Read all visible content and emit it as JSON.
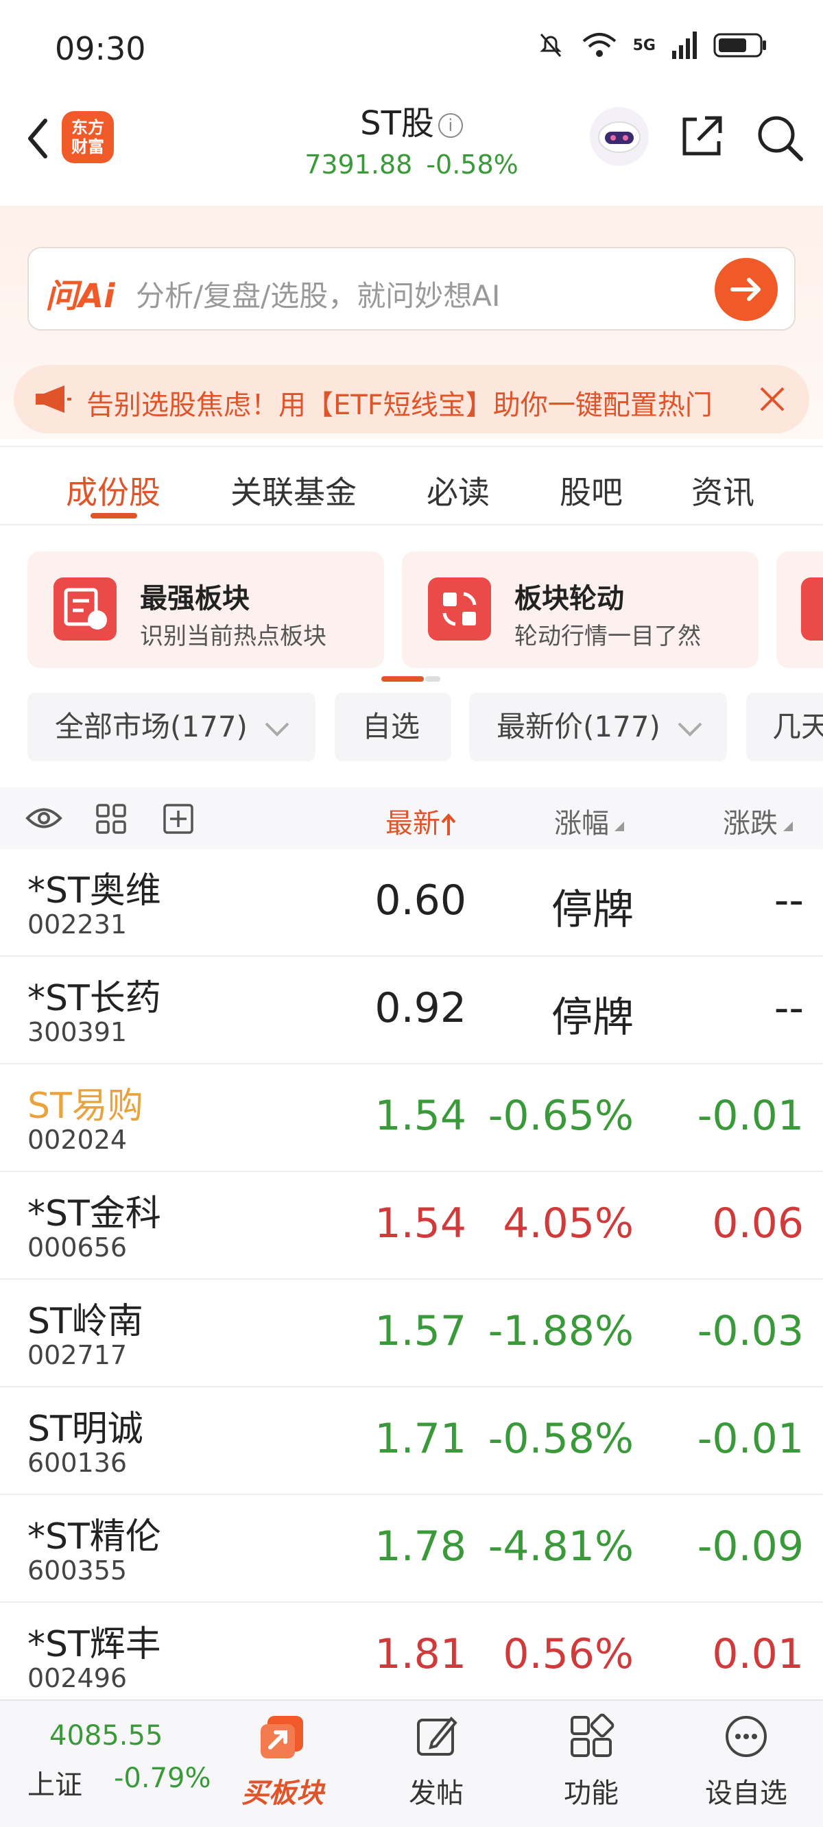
{
  "status": {
    "time": "09:30",
    "network": "5G"
  },
  "header": {
    "logo_line1": "东方",
    "logo_line2": "财富",
    "title": "ST股",
    "index_value": "7391.88",
    "index_change": "-0.58%"
  },
  "ai": {
    "logo": "问Ai",
    "placeholder": "分析/复盘/选股，就问妙想AI"
  },
  "banner": {
    "text": "告别选股焦虑！用【ETF短线宝】助你一键配置热门"
  },
  "tabs": [
    "成份股",
    "关联基金",
    "必读",
    "股吧",
    "资讯"
  ],
  "cards": [
    {
      "title": "最强板块",
      "subtitle": "识别当前热点板块"
    },
    {
      "title": "板块轮动",
      "subtitle": "轮动行情一目了然"
    }
  ],
  "filters": {
    "market": "全部市场(177)",
    "watchlist": "自选",
    "price": "最新价(177)",
    "days": "几天"
  },
  "table": {
    "headers": {
      "latest": "最新",
      "change_pct": "涨幅",
      "change": "涨跌"
    },
    "rows": [
      {
        "name": "*ST奥维",
        "code": "002231",
        "price": "0.60",
        "pct": "停牌",
        "chg": "--",
        "trend": "flat"
      },
      {
        "name": "*ST长药",
        "code": "300391",
        "price": "0.92",
        "pct": "停牌",
        "chg": "--",
        "trend": "flat"
      },
      {
        "name": "ST易购",
        "code": "002024",
        "price": "1.54",
        "pct": "-0.65%",
        "chg": "-0.01",
        "trend": "down"
      },
      {
        "name": "*ST金科",
        "code": "000656",
        "price": "1.54",
        "pct": "4.05%",
        "chg": "0.06",
        "trend": "up"
      },
      {
        "name": "ST岭南",
        "code": "002717",
        "price": "1.57",
        "pct": "-1.88%",
        "chg": "-0.03",
        "trend": "down"
      },
      {
        "name": "ST明诚",
        "code": "600136",
        "price": "1.71",
        "pct": "-0.58%",
        "chg": "-0.01",
        "trend": "down"
      },
      {
        "name": "*ST精伦",
        "code": "600355",
        "price": "1.78",
        "pct": "-4.81%",
        "chg": "-0.09",
        "trend": "down"
      },
      {
        "name": "*ST辉丰",
        "code": "002496",
        "price": "1.81",
        "pct": "0.56%",
        "chg": "0.01",
        "trend": "up"
      }
    ]
  },
  "bottom": {
    "index_value": "4085.55",
    "index_name": "上证",
    "index_change": "-0.79%",
    "buy_label": "买板块",
    "post_label": "发帖",
    "func_label": "功能",
    "watch_label": "设自选"
  },
  "colors": {
    "accent": "#f05a28",
    "up": "#d03a3a",
    "down": "#3a9a3a",
    "highlight": "#e8a33c"
  }
}
